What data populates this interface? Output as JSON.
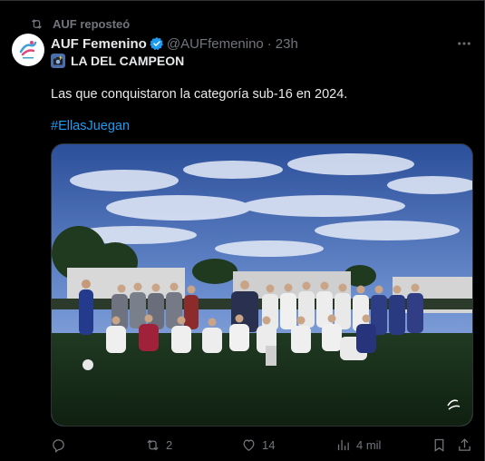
{
  "repost": {
    "label": "AUF reposteó",
    "icon": "repost-icon"
  },
  "post": {
    "author_name": "AUF Femenino",
    "verified": true,
    "handle": "@AUFfemenino",
    "separator": "·",
    "time": "23h",
    "line1_emoji": "camera-flash-icon",
    "line1_text": "LA DEL CAMPEON",
    "line2_text": "Las que conquistaron la categoría sub-16 en 2024.",
    "hashtag": "#EllasJuegan",
    "image_alt": "Team photo of the sub-16 women's squad with trophy on a football pitch"
  },
  "actions": {
    "reply_count": "",
    "repost_count": "2",
    "like_count": "14",
    "views_count": "4 mil"
  },
  "colors": {
    "background": "#000000",
    "text": "#e7e9ea",
    "muted": "#71767b",
    "link": "#1d9bf0",
    "border": "#2f3336"
  }
}
